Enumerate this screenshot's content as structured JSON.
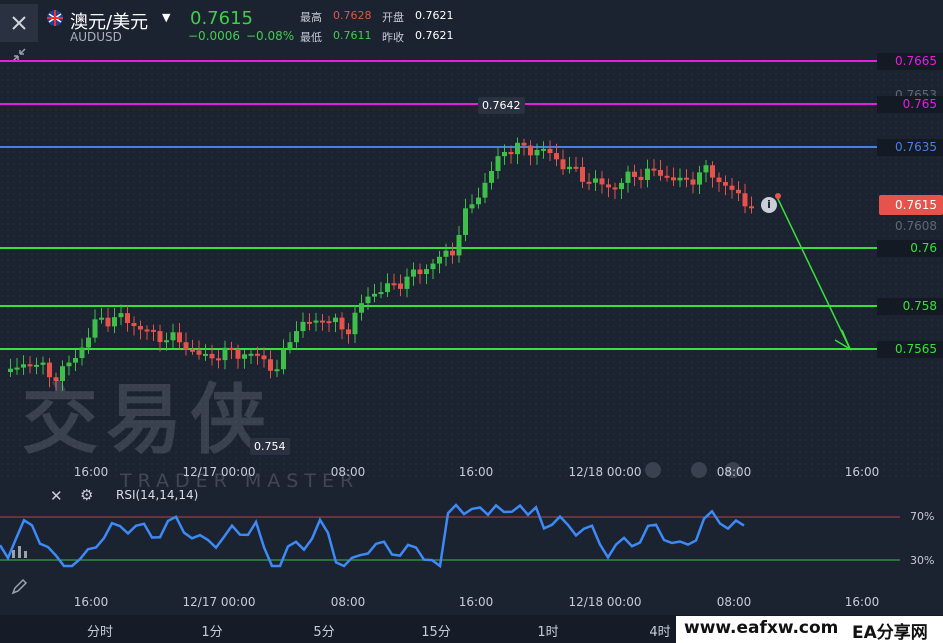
{
  "header": {
    "symbol_cn": "澳元/美元",
    "symbol_code": "AUDUSD",
    "price": "0.7615",
    "change": "−0.0006",
    "change_pct": "−0.08%",
    "high_label": "最高",
    "high_value": "0.7628",
    "low_label": "最低",
    "low_value": "0.7611",
    "open_label": "开盘",
    "open_value": "0.7621",
    "prev_close_label": "昨收",
    "prev_close_value": "0.7621"
  },
  "price_labels": {
    "l7665": "0.7665",
    "l7653": "0.7653",
    "l765": "0.765",
    "l7635": "0.7635",
    "current": "0.7615",
    "l7608": "0.7608",
    "l76": "0.76",
    "l758": "0.758",
    "l7565": "0.7565"
  },
  "annotations": {
    "high_marker": "0.7642",
    "low_marker": "0.754"
  },
  "watermark": {
    "cn": "交易侠",
    "en": "TRADER MASTER"
  },
  "time_axis": [
    "16:00",
    "12/17 00:00",
    "08:00",
    "16:00",
    "12/18 00:00",
    "08:00",
    "16:00"
  ],
  "rsi": {
    "label": "RSI(14,14,14)",
    "level_high": "70%",
    "level_low": "30%"
  },
  "timeframes": [
    "分时",
    "1分",
    "5分",
    "15分",
    "1时",
    "4时"
  ],
  "footer_brand": {
    "url": "www.eafxw.com",
    "name": "EA分享网"
  },
  "colors": {
    "up": "#3fbf4a",
    "down": "#e5534b",
    "magenta": "#e31ee3",
    "blue": "#4a7fe0",
    "green_line": "#39e03a",
    "rsi": "#3d8af7"
  }
}
